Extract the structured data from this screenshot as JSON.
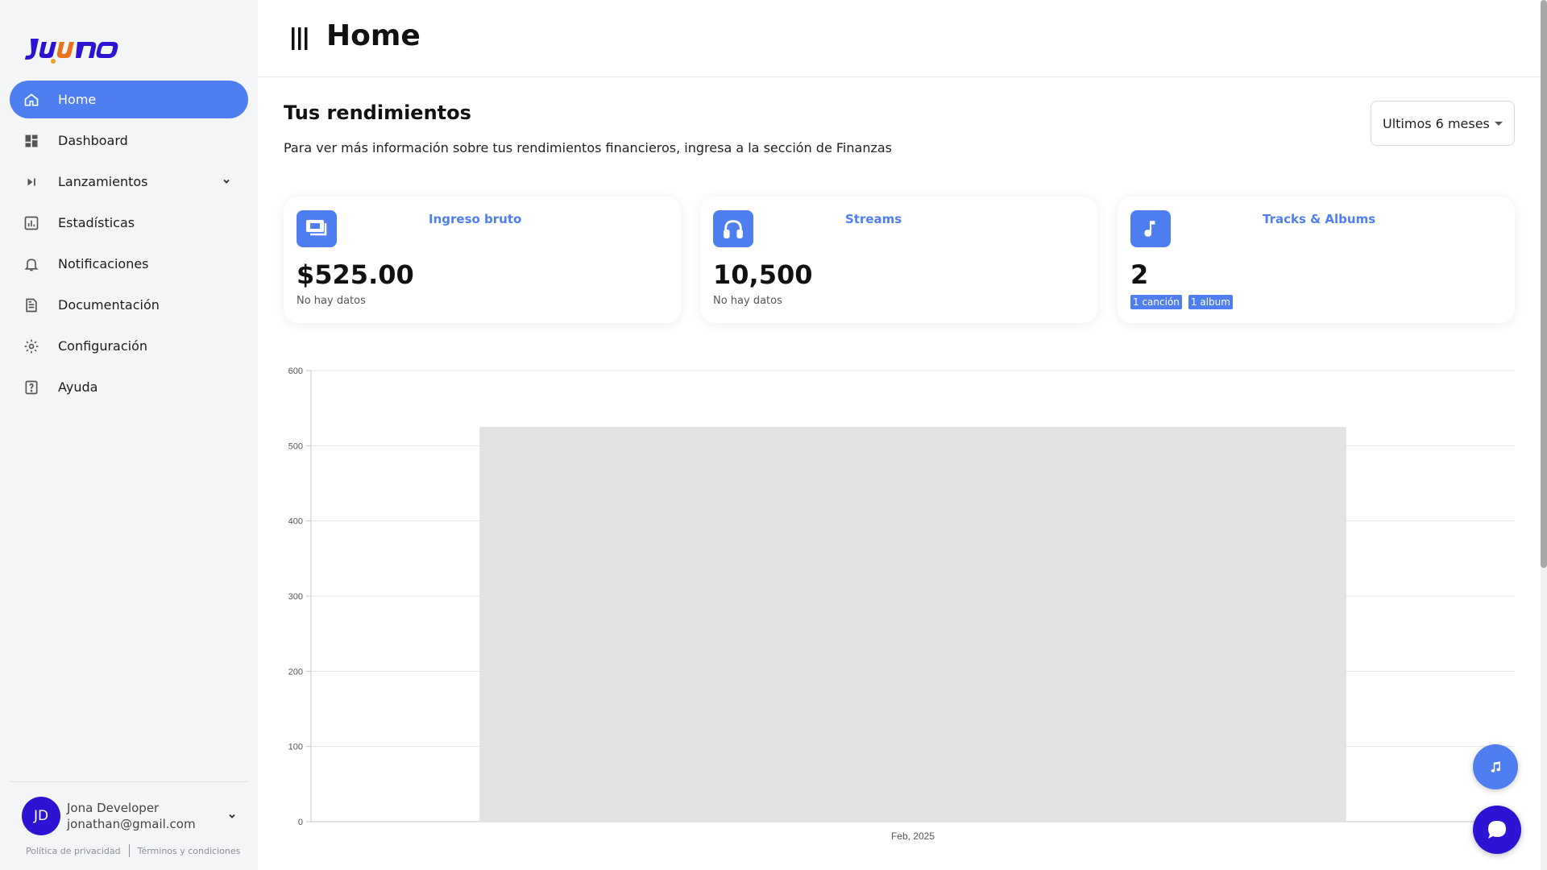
{
  "sidebar": {
    "items": [
      {
        "label": "Home",
        "icon": "home-icon",
        "active": true
      },
      {
        "label": "Dashboard",
        "icon": "dashboard-icon"
      },
      {
        "label": "Lanzamientos",
        "icon": "skip-next-icon",
        "expandable": true
      },
      {
        "label": "Estadísticas",
        "icon": "bar-chart-icon"
      },
      {
        "label": "Notificaciones",
        "icon": "bell-icon"
      },
      {
        "label": "Documentación",
        "icon": "document-icon"
      },
      {
        "label": "Configuración",
        "icon": "gear-icon"
      },
      {
        "label": "Ayuda",
        "icon": "help-icon"
      }
    ],
    "user": {
      "initials": "JD",
      "name": "Jona Developer",
      "email": "jonathan@gmail.com"
    },
    "legal": {
      "privacy": "Política de privacidad",
      "terms": "Términos y condiciones"
    }
  },
  "header": {
    "title": "Home"
  },
  "main": {
    "section_title": "Tus rendimientos",
    "section_subtitle": "Para ver más información sobre tus rendimientos financieros, ingresa a la sección de Finanzas",
    "period_select": "Ultimos 6 meses",
    "cards": [
      {
        "title": "Ingreso bruto",
        "value": "$525.00",
        "note": "No hay datos",
        "icon": "money-icon"
      },
      {
        "title": "Streams",
        "value": "10,500",
        "note": "No hay datos",
        "icon": "headphones-icon"
      },
      {
        "title": "Tracks & Albums",
        "value": "2",
        "badges": [
          "1 canción",
          "1 album"
        ],
        "icon": "music-note-icon"
      }
    ]
  },
  "colors": {
    "accent": "#4f7ef0",
    "brand": "#2d13d4",
    "bar": "#e3e3e3"
  },
  "chart_data": {
    "type": "bar",
    "categories": [
      "Feb, 2025"
    ],
    "values": [
      525
    ],
    "ylim": [
      0,
      600
    ],
    "yticks": [
      0,
      100,
      200,
      300,
      400,
      500,
      600
    ],
    "grid": true,
    "title": "",
    "xlabel": "",
    "ylabel": ""
  }
}
